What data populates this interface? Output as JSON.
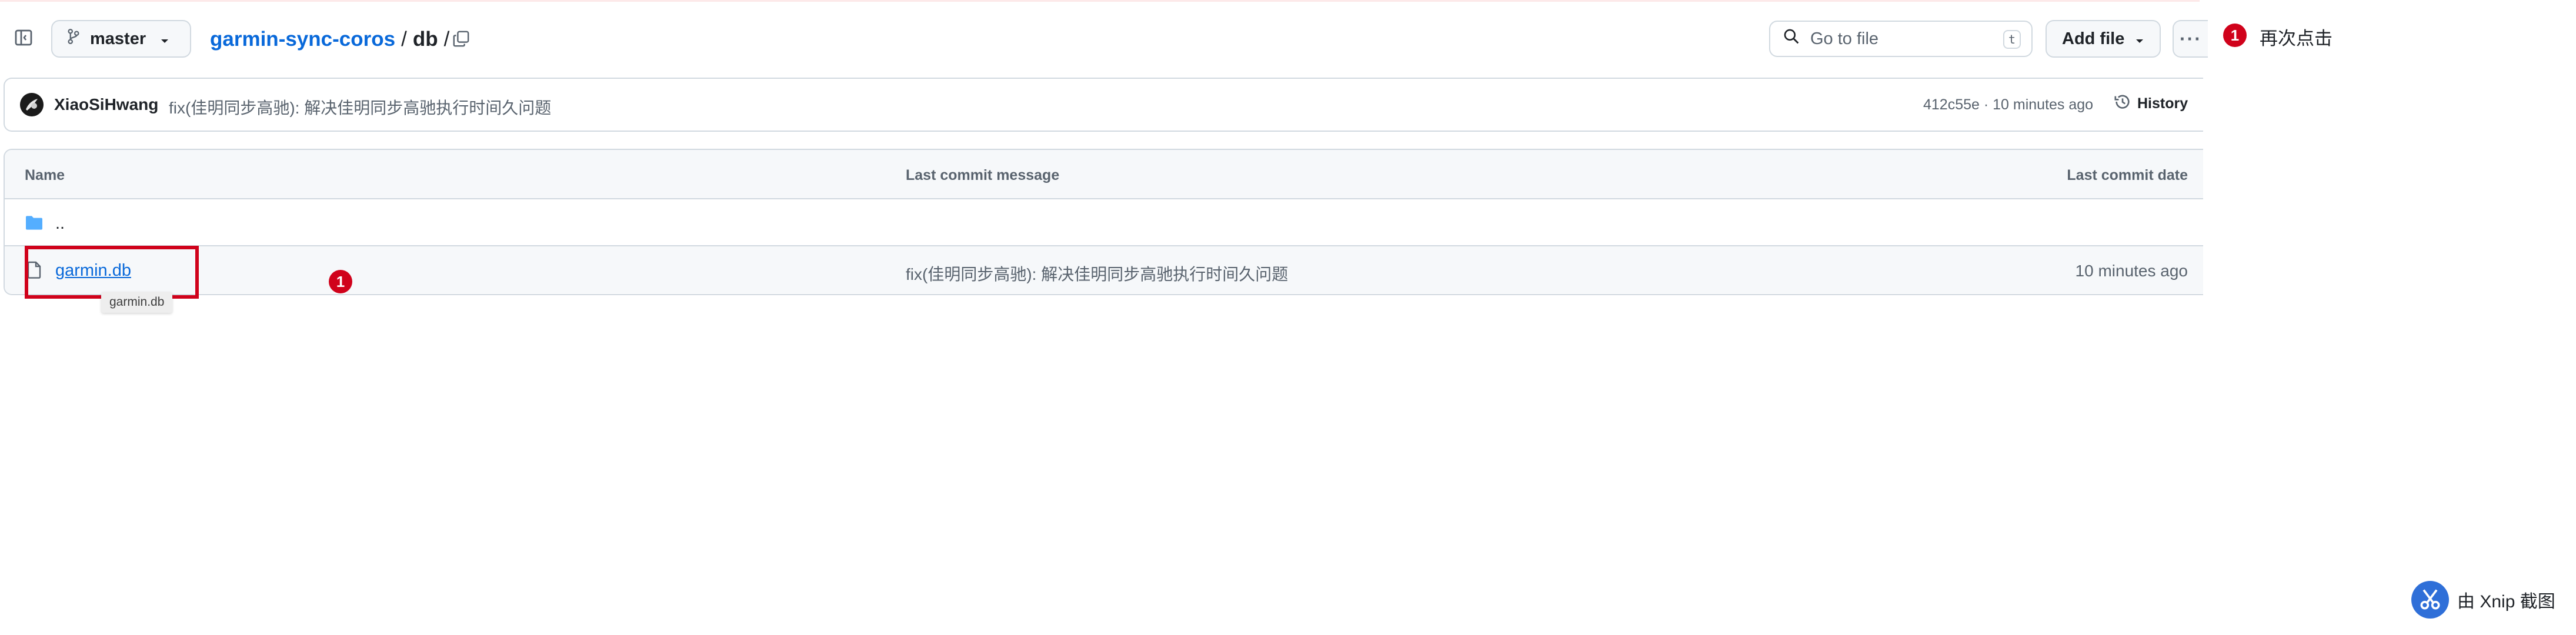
{
  "header": {
    "branch": "master",
    "breadcrumb": {
      "repo": "garmin-sync-coros",
      "sep1": "/",
      "folder": "db",
      "sep2": "/"
    },
    "search_placeholder": "Go to file",
    "search_shortcut": "t",
    "add_file_label": "Add file",
    "more_label": "···"
  },
  "commit": {
    "user": "XiaoSiHwang",
    "message": "fix(佳明同步高驰): 解决佳明同步高驰执行时间久问题",
    "meta": "412c55e · 10 minutes ago",
    "history_label": "History"
  },
  "table": {
    "headers": {
      "name": "Name",
      "message": "Last commit message",
      "date": "Last commit date"
    },
    "rows": [
      {
        "name": "..",
        "message": "",
        "date": ""
      },
      {
        "name": "garmin.db",
        "message": "fix(佳明同步高驰): 解决佳明同步高驰执行时间久问题",
        "date": "10 minutes ago"
      }
    ]
  },
  "tooltip": "garmin.db",
  "annotation": {
    "badge_number": "1",
    "note": "再次点击",
    "accent_color": "#d0021b"
  },
  "watermark": "由 Xnip 截图",
  "icons": [
    "sidebar-toggle-icon",
    "branch-icon",
    "copy-icon",
    "search-icon",
    "avatar",
    "history-icon",
    "folder-icon",
    "file-icon"
  ]
}
